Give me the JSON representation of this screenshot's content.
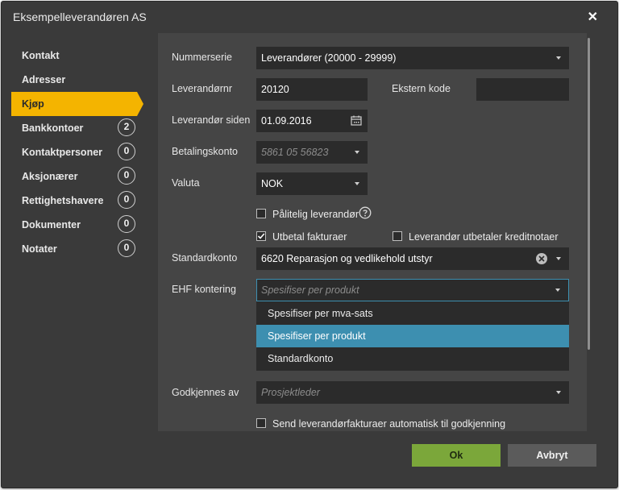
{
  "window": {
    "title": "Eksempelleverandøren AS",
    "close_glyph": "✕"
  },
  "nav": [
    {
      "label": "Kontakt",
      "badge": null,
      "active": false
    },
    {
      "label": "Adresser",
      "badge": null,
      "active": false
    },
    {
      "label": "Kjøp",
      "badge": null,
      "active": true
    },
    {
      "label": "Bankkontoer",
      "badge": "2",
      "active": false
    },
    {
      "label": "Kontaktpersoner",
      "badge": "0",
      "active": false
    },
    {
      "label": "Aksjonærer",
      "badge": "0",
      "active": false
    },
    {
      "label": "Rettighetshavere",
      "badge": "0",
      "active": false
    },
    {
      "label": "Dokumenter",
      "badge": "0",
      "active": false
    },
    {
      "label": "Notater",
      "badge": "0",
      "active": false
    }
  ],
  "form": {
    "nummerserie_label": "Nummerserie",
    "nummerserie_value": "Leverandører (20000 - 29999)",
    "leverandornr_label": "Leverandørnr",
    "leverandornr_value": "20120",
    "ekstern_kode_label": "Ekstern kode",
    "ekstern_kode_value": "",
    "siden_label": "Leverandør siden",
    "siden_value": "01.09.2016",
    "betalingskonto_label": "Betalingskonto",
    "betalingskonto_placeholder": "5861 05 56823",
    "valuta_label": "Valuta",
    "valuta_value": "NOK",
    "palitelig_label": "Pålitelig leverandør",
    "palitelig_checked": false,
    "utbetal_label": "Utbetal fakturaer",
    "utbetal_checked": true,
    "kreditnotaer_label": "Leverandør utbetaler kreditnotaer",
    "kreditnotaer_checked": false,
    "standardkonto_label": "Standardkonto",
    "standardkonto_value": "6620 Reparasjon og vedlikehold utstyr",
    "ehf_label": "EHF kontering",
    "ehf_placeholder": "Spesifiser per produkt",
    "ehf_options": [
      "Spesifiser per mva-sats",
      "Spesifiser per produkt",
      "Standardkonto"
    ],
    "ehf_selected_index": 1,
    "godkjennes_label": "Godkjennes av",
    "godkjennes_placeholder": "Prosjektleder",
    "send_label": "Send leverandørfakturaer automatisk til godkjenning",
    "send_checked": false
  },
  "buttons": {
    "ok": "Ok",
    "cancel": "Avbryt"
  },
  "colors": {
    "accent": "#f4b400",
    "ok": "#7ba73a",
    "selected_option": "#3d8fb0"
  }
}
